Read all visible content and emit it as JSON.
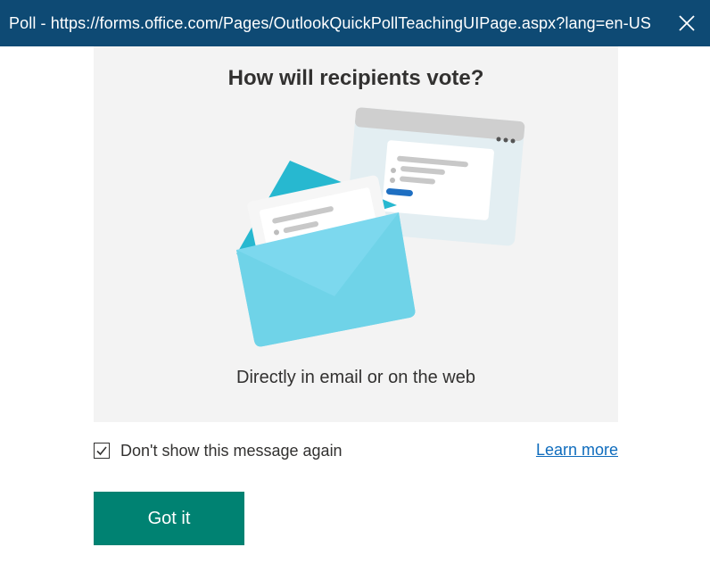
{
  "window": {
    "title": "Poll - https://forms.office.com/Pages/OutlookQuickPollTeachingUIPage.aspx?lang=en-US",
    "close_icon": "close-icon"
  },
  "panel": {
    "heading": "How will recipients vote?",
    "illustration_icon": "email-and-web-poll-illustration",
    "subtitle": "Directly in email or on the web"
  },
  "footer": {
    "checkbox_label": "Don't show this message again",
    "checkbox_checked": true,
    "learn_more_label": "Learn more",
    "got_it_label": "Got it"
  },
  "colors": {
    "titlebar": "#0e4a74",
    "panel_bg": "#f3f3f3",
    "primary_button": "#008272",
    "link": "#0f6cbd",
    "envelope": "#6fd3e8",
    "envelope_flap": "#27b8d0"
  }
}
